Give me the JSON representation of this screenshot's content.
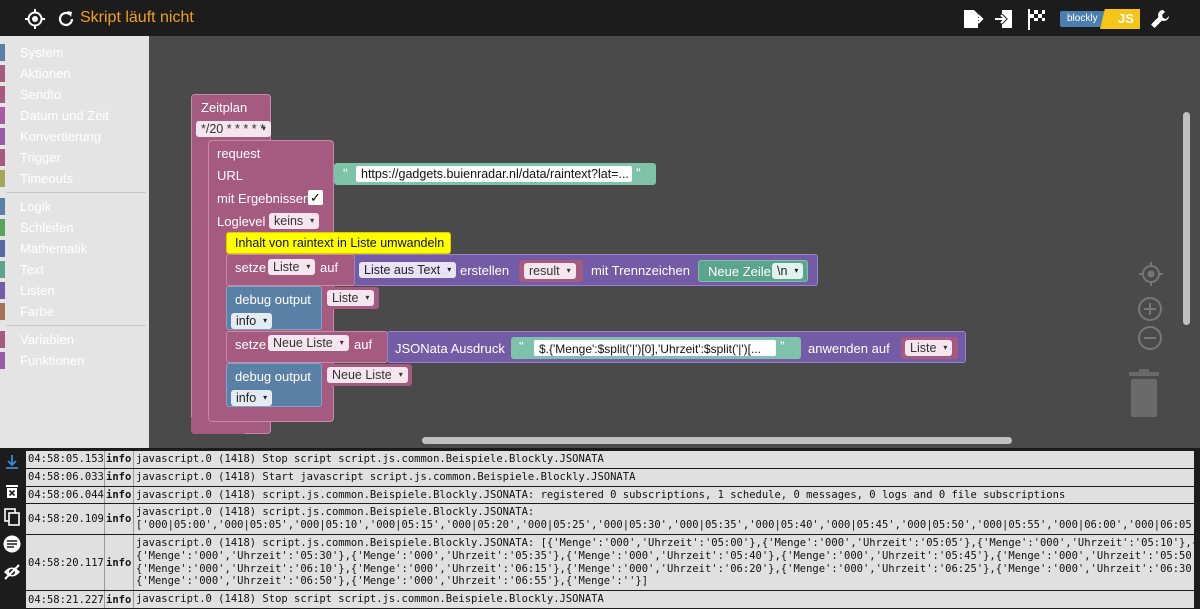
{
  "topbar": {
    "status": "Skript läuft nicht",
    "logo_left": "blockly",
    "logo_right": "JS",
    "icons": [
      "crosshair-icon",
      "reload-icon",
      "export-icon",
      "import-icon",
      "flag-icon",
      "wrench-icon"
    ]
  },
  "toolbox": {
    "groups": [
      [
        {
          "label": "System",
          "color": "#5b80a5"
        },
        {
          "label": "Aktionen",
          "color": "#a55b80"
        },
        {
          "label": "Sendto",
          "color": "#a55b80"
        },
        {
          "label": "Datum und Zeit",
          "color": "#a55ba5"
        },
        {
          "label": "Konvertierung",
          "color": "#995ba5"
        },
        {
          "label": "Trigger",
          "color": "#a55b80"
        },
        {
          "label": "Timeouts",
          "color": "#a5a55b"
        }
      ],
      [
        {
          "label": "Logik",
          "color": "#5b80a5"
        },
        {
          "label": "Schleifen",
          "color": "#5ba55b"
        },
        {
          "label": "Mathematik",
          "color": "#5b67a5"
        },
        {
          "label": "Text",
          "color": "#5ba58c"
        },
        {
          "label": "Listen",
          "color": "#745ba5"
        },
        {
          "label": "Farbe",
          "color": "#a5745b"
        }
      ],
      [
        {
          "label": "Variablen",
          "color": "#a55b80"
        },
        {
          "label": "Funktionen",
          "color": "#995ba5"
        }
      ]
    ]
  },
  "blocks": {
    "schedule": {
      "title": "Zeitplan",
      "cron": "*/20 * * * * *"
    },
    "request": {
      "title": "request",
      "url_label": "URL",
      "url_value": "https://gadgets.buienradar.nl/data/raintext?lat=...",
      "with_results_label": "mit Ergebnissen",
      "with_results_check": "✓",
      "loglevel_label": "Loglevel",
      "loglevel_value": "keins"
    },
    "comment": "Inhalt von raintext in Liste umwandeln",
    "set1": {
      "label": "setze",
      "var": "Liste",
      "on": "auf",
      "list_from_text": "Liste aus Text",
      "create": "erstellen",
      "result": "result",
      "sep_label": "mit Trennzeichen",
      "newline_label": "Neue Zeile",
      "newline_value": "\\n"
    },
    "debug1": {
      "label": "debug output",
      "var": "Liste",
      "level": "info"
    },
    "set2": {
      "label": "setze",
      "var": "Neue Liste",
      "on": "auf",
      "jsonata_label": "JSONata Ausdruck",
      "expr": "$.{'Menge':$split('|')[0],'Uhrzeit':$split('|')[...",
      "apply_label": "anwenden auf",
      "apply_var": "Liste"
    },
    "debug2": {
      "label": "debug output",
      "var": "Neue Liste",
      "level": "info"
    }
  },
  "log": [
    {
      "time": "04:58:05.153",
      "sev": "info",
      "msg": "javascript.0 (1418) Stop script script.js.common.Beispiele.Blockly.JSONATA"
    },
    {
      "time": "04:58:06.033",
      "sev": "info",
      "msg": "javascript.0 (1418) Start javascript script.js.common.Beispiele.Blockly.JSONATA"
    },
    {
      "time": "04:58:06.044",
      "sev": "info",
      "msg": "javascript.0 (1418) script.js.common.Beispiele.Blockly.JSONATA: registered 0 subscriptions, 1 schedule, 0 messages, 0 logs and 0 file subscriptions"
    },
    {
      "time": "04:58:20.109",
      "sev": "info",
      "msg": "javascript.0 (1418) script.js.common.Beispiele.Blockly.JSONATA:\n['000|05:00','000|05:05','000|05:10','000|05:15','000|05:20','000|05:25','000|05:30','000|05:35','000|05:40','000|05:45','000|05:50','000|05:55','000|06:00','000|06:05','000|06"
    },
    {
      "time": "04:58:20.117",
      "sev": "info",
      "msg": "javascript.0 (1418) script.js.common.Beispiele.Blockly.JSONATA: [{'Menge':'000','Uhrzeit':'05:00'},{'Menge':'000','Uhrzeit':'05:05'},{'Menge':'000','Uhrzeit':'05:10'},{'Menge':\n{'Menge':'000','Uhrzeit':'05:30'},{'Menge':'000','Uhrzeit':'05:35'},{'Menge':'000','Uhrzeit':'05:40'},{'Menge':'000','Uhrzeit':'05:45'},{'Menge':'000','Uhrzeit':'05:50'},{'Menge\n{'Menge':'000','Uhrzeit':'06:10'},{'Menge':'000','Uhrzeit':'06:15'},{'Menge':'000','Uhrzeit':'06:20'},{'Menge':'000','Uhrzeit':'06:25'},{'Menge':'000','Uhrzeit':'06:30'},{'Menge\n{'Menge':'000','Uhrzeit':'06:50'},{'Menge':'000','Uhrzeit':'06:55'},{'Menge':''}]"
    },
    {
      "time": "04:58:21.227",
      "sev": "info",
      "msg": "javascript.0 (1418) Stop script script.js.common.Beispiele.Blockly.JSONATA"
    }
  ],
  "colors": {
    "event": "#a55b80",
    "value_text": "#5ba58c",
    "list": "#745ba5",
    "debug": "#5b80a5",
    "comment": "#ffff00",
    "status": "#f0a020"
  }
}
